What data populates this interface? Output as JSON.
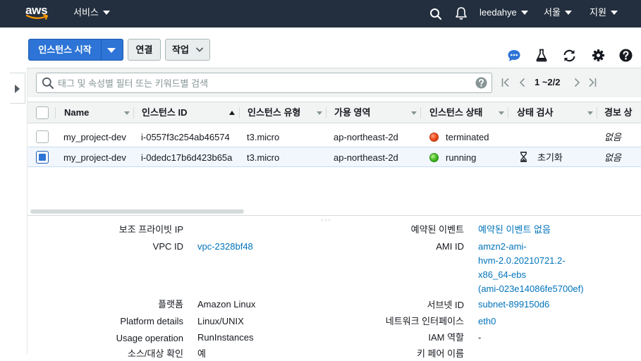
{
  "topbar": {
    "logo_text": "aws",
    "services_label": "서비스",
    "user_label": "leedahye",
    "region_label": "서울",
    "support_label": "지원"
  },
  "toolbar": {
    "launch_label": "인스턴스 시작",
    "connect_label": "연결",
    "actions_label": "작업"
  },
  "icons": {
    "feedback": "chat-bubble-icon",
    "lab": "flask-icon",
    "refresh": "refresh-icon",
    "settings": "gear-icon",
    "help": "help-icon"
  },
  "filter": {
    "placeholder": "태그 및 속성별 필터 또는 키워드별 검색",
    "pager_text": "1 ~2/2"
  },
  "columns": [
    {
      "label": "Name"
    },
    {
      "label": "인스턴스 ID"
    },
    {
      "label": "인스턴스 유형"
    },
    {
      "label": "가용 영역"
    },
    {
      "label": "인스턴스 상태"
    },
    {
      "label": "상태 검사"
    },
    {
      "label": "경보 상"
    }
  ],
  "rows": [
    {
      "name": "my_project-dev",
      "id": "i-0557f3c254ab46574",
      "type": "t3.micro",
      "az": "ap-northeast-2d",
      "state": "terminated",
      "state_color": "#e0461c",
      "check": "",
      "alarm": "없음",
      "selected": false
    },
    {
      "name": "my_project-dev",
      "id": "i-0dedc17b6d423b65a",
      "type": "t3.micro",
      "az": "ap-northeast-2d",
      "state": "running",
      "state_color": "#3cb81e",
      "check": "초기화",
      "alarm": "없음",
      "selected": true
    }
  ],
  "details": {
    "left": [
      {
        "label": "보조 프라이빗 IP",
        "value": ""
      },
      {
        "label": "VPC ID",
        "value": "vpc-2328bf48"
      },
      {
        "label": "플랫폼",
        "value": "Amazon Linux"
      },
      {
        "label": "Platform details",
        "value": "Linux/UNIX"
      },
      {
        "label": "Usage operation",
        "value": "RunInstances"
      },
      {
        "label": "소스/대상 확인",
        "value": "예"
      }
    ],
    "right": [
      {
        "label": "예약된 이벤트",
        "value": "예약된 이벤트 없음"
      },
      {
        "label": "AMI ID",
        "value_lines": [
          "amzn2-ami-",
          "hvm-2.0.20210721.2-",
          "x86_64-ebs",
          "(ami-023e14086fe5700ef)"
        ]
      },
      {
        "label": "서브넷 ID",
        "value": "subnet-899150d6"
      },
      {
        "label": "네트워크 인터페이스",
        "value": "eth0"
      },
      {
        "label": "IAM 역할",
        "value": "-"
      },
      {
        "label": "키 페어 이름",
        "value": ""
      }
    ]
  },
  "colors": {
    "topbar_bg": "#232f3e",
    "primary": "#2d74d6",
    "link": "#0073bb"
  }
}
